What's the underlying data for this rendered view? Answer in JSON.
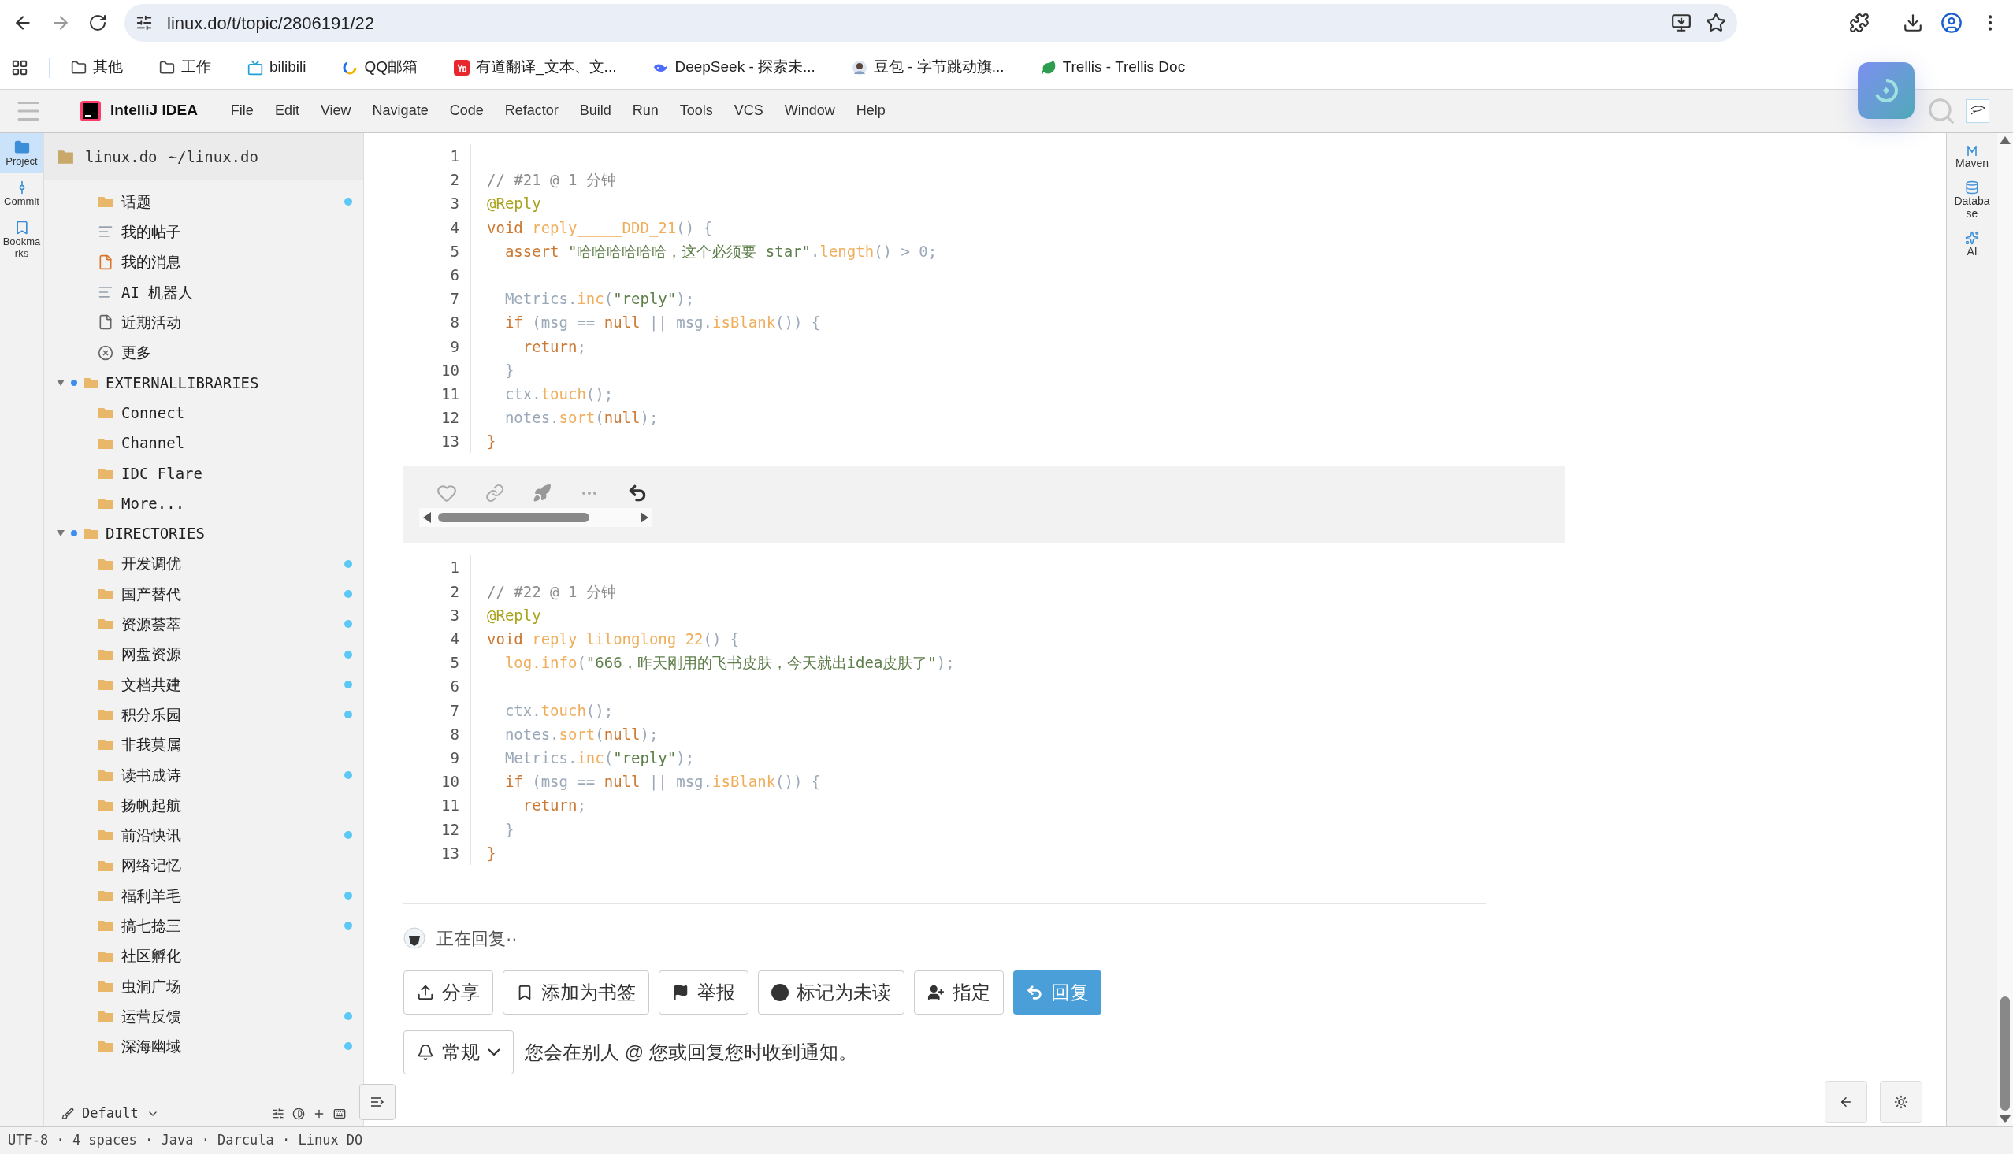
{
  "browser": {
    "url": "linux.do/t/topic/2806191/22",
    "bookmarks": [
      {
        "label": "其他",
        "kind": "folder"
      },
      {
        "label": "工作",
        "kind": "folder"
      },
      {
        "label": "bilibili",
        "kind": "tv"
      },
      {
        "label": "QQ邮箱",
        "kind": "ring"
      },
      {
        "label": "有道翻译_文本、文...",
        "kind": "yd"
      },
      {
        "label": "DeepSeek - 探索未...",
        "kind": "whale"
      },
      {
        "label": "豆包 - 字节跳动旗...",
        "kind": "avatar"
      },
      {
        "label": "Trellis - Trellis Doc",
        "kind": "leaf"
      }
    ]
  },
  "ide": {
    "app_name": "IntelliJ IDEA",
    "menu": [
      "File",
      "Edit",
      "View",
      "Navigate",
      "Code",
      "Refactor",
      "Build",
      "Run",
      "Tools",
      "VCS",
      "Window",
      "Help"
    ],
    "left_tools": [
      {
        "label": "Project",
        "kind": "folder",
        "selected": true
      },
      {
        "label": "Commit",
        "kind": "commit",
        "selected": false
      },
      {
        "label": "Bookmarks",
        "kind": "bookmark",
        "selected": false
      }
    ],
    "right_tools": [
      {
        "label": "Maven",
        "kind": "maven"
      },
      {
        "label": "Database",
        "kind": "database"
      },
      {
        "label": "AI",
        "kind": "sparkle"
      }
    ]
  },
  "sidebar": {
    "project": "linux.do",
    "path": "~/linux.do",
    "items": [
      {
        "label": "话题",
        "kind": "folder",
        "dot": true
      },
      {
        "label": "我的帖子",
        "kind": "lines",
        "dot": false
      },
      {
        "label": "我的消息",
        "kind": "file-orange",
        "dot": false
      },
      {
        "label": "AI 机器人",
        "kind": "lines",
        "dot": false
      },
      {
        "label": "近期活动",
        "kind": "file",
        "dot": false
      },
      {
        "label": "更多",
        "kind": "more",
        "dot": false
      },
      {
        "label": "EXTERNALLIBRARIES",
        "kind": "group",
        "expanded": true,
        "children": [
          {
            "label": "Connect",
            "kind": "folder",
            "dot": false
          },
          {
            "label": "Channel",
            "kind": "folder",
            "dot": false
          },
          {
            "label": "IDC Flare",
            "kind": "folder",
            "dot": false
          },
          {
            "label": "More...",
            "kind": "folder",
            "dot": false
          }
        ]
      },
      {
        "label": "DIRECTORIES",
        "kind": "group",
        "expanded": true,
        "children": [
          {
            "label": "开发调优",
            "kind": "folder",
            "dot": true
          },
          {
            "label": "国产替代",
            "kind": "folder",
            "dot": true
          },
          {
            "label": "资源荟萃",
            "kind": "folder",
            "dot": true
          },
          {
            "label": "网盘资源",
            "kind": "folder",
            "dot": true
          },
          {
            "label": "文档共建",
            "kind": "folder",
            "dot": true
          },
          {
            "label": "积分乐园",
            "kind": "folder",
            "dot": true
          },
          {
            "label": "非我莫属",
            "kind": "folder",
            "dot": false
          },
          {
            "label": "读书成诗",
            "kind": "folder",
            "dot": true
          },
          {
            "label": "扬帆起航",
            "kind": "folder",
            "dot": false
          },
          {
            "label": "前沿快讯",
            "kind": "folder",
            "dot": true
          },
          {
            "label": "网络记忆",
            "kind": "folder",
            "dot": false
          },
          {
            "label": "福利羊毛",
            "kind": "folder",
            "dot": true
          },
          {
            "label": "搞七捻三",
            "kind": "folder",
            "dot": true
          },
          {
            "label": "社区孵化",
            "kind": "folder",
            "dot": false
          },
          {
            "label": "虫洞广场",
            "kind": "folder",
            "dot": false
          },
          {
            "label": "运营反馈",
            "kind": "folder",
            "dot": true
          },
          {
            "label": "深海幽域",
            "kind": "folder",
            "dot": true
          }
        ]
      }
    ],
    "theme": "Default"
  },
  "posts": [
    {
      "lines": [
        {
          "number": "1"
        },
        {
          "number": "2",
          "tokens": [
            {
              "t": "// #21 @ 1 分钟",
              "kind": "comment"
            }
          ]
        },
        {
          "number": "3",
          "tokens": [
            {
              "t": "@Reply",
              "kind": "annotation"
            }
          ]
        },
        {
          "number": "4",
          "tokens": [
            {
              "t": "void ",
              "kind": "keyword"
            },
            {
              "t": "reply_____DDD_21",
              "kind": "function"
            },
            {
              "t": "() {",
              "kind": "plain"
            }
          ]
        },
        {
          "number": "5",
          "tokens": [
            {
              "t": "  assert ",
              "kind": "keyword"
            },
            {
              "t": "\"哈哈哈哈哈哈，这个必须要 star\"",
              "kind": "string"
            },
            {
              "t": ".",
              "kind": "plain"
            },
            {
              "t": "length",
              "kind": "function"
            },
            {
              "t": "() > 0;",
              "kind": "plain"
            }
          ]
        },
        {
          "number": "6"
        },
        {
          "number": "7",
          "tokens": [
            {
              "t": "  Metrics.",
              "kind": "plain"
            },
            {
              "t": "inc",
              "kind": "function"
            },
            {
              "t": "(",
              "kind": "plain"
            },
            {
              "t": "\"reply\"",
              "kind": "string"
            },
            {
              "t": ");",
              "kind": "plain"
            }
          ]
        },
        {
          "number": "8",
          "tokens": [
            {
              "t": "  if ",
              "kind": "keyword"
            },
            {
              "t": "(msg == ",
              "kind": "plain"
            },
            {
              "t": "null",
              "kind": "keyword"
            },
            {
              "t": " || msg.",
              "kind": "plain"
            },
            {
              "t": "isBlank",
              "kind": "function"
            },
            {
              "t": "()) {",
              "kind": "plain"
            }
          ]
        },
        {
          "number": "9",
          "tokens": [
            {
              "t": "    return",
              "kind": "keyword"
            },
            {
              "t": ";",
              "kind": "plain"
            }
          ]
        },
        {
          "number": "10",
          "tokens": [
            {
              "t": "  }",
              "kind": "plain"
            }
          ]
        },
        {
          "number": "11",
          "tokens": [
            {
              "t": "  ctx.",
              "kind": "plain"
            },
            {
              "t": "touch",
              "kind": "function"
            },
            {
              "t": "();",
              "kind": "plain"
            }
          ]
        },
        {
          "number": "12",
          "tokens": [
            {
              "t": "  notes.",
              "kind": "plain"
            },
            {
              "t": "sort",
              "kind": "function"
            },
            {
              "t": "(",
              "kind": "plain"
            },
            {
              "t": "null",
              "kind": "keyword"
            },
            {
              "t": ");",
              "kind": "plain"
            }
          ]
        },
        {
          "number": "13",
          "tokens": [
            {
              "t": "}",
              "kind": "keyword"
            }
          ]
        }
      ],
      "actions": true
    },
    {
      "lines": [
        {
          "number": "1"
        },
        {
          "number": "2",
          "tokens": [
            {
              "t": "// #22 @ 1 分钟",
              "kind": "comment"
            }
          ]
        },
        {
          "number": "3",
          "tokens": [
            {
              "t": "@Reply",
              "kind": "annotation"
            }
          ]
        },
        {
          "number": "4",
          "tokens": [
            {
              "t": "void ",
              "kind": "keyword"
            },
            {
              "t": "reply_lilonglong_22",
              "kind": "function"
            },
            {
              "t": "() {",
              "kind": "plain"
            }
          ]
        },
        {
          "number": "5",
          "tokens": [
            {
              "t": "  log.info",
              "kind": "function"
            },
            {
              "t": "(",
              "kind": "plain"
            },
            {
              "t": "\"666，昨天刚用的飞书皮肤，今天就出idea皮肤了\"",
              "kind": "string"
            },
            {
              "t": ");",
              "kind": "plain"
            }
          ]
        },
        {
          "number": "6"
        },
        {
          "number": "7",
          "tokens": [
            {
              "t": "  ctx.",
              "kind": "plain"
            },
            {
              "t": "touch",
              "kind": "function"
            },
            {
              "t": "();",
              "kind": "plain"
            }
          ]
        },
        {
          "number": "8",
          "tokens": [
            {
              "t": "  notes.",
              "kind": "plain"
            },
            {
              "t": "sort",
              "kind": "function"
            },
            {
              "t": "(",
              "kind": "plain"
            },
            {
              "t": "null",
              "kind": "keyword"
            },
            {
              "t": ");",
              "kind": "plain"
            }
          ]
        },
        {
          "number": "9",
          "tokens": [
            {
              "t": "  Metrics.",
              "kind": "plain"
            },
            {
              "t": "inc",
              "kind": "function"
            },
            {
              "t": "(",
              "kind": "plain"
            },
            {
              "t": "\"reply\"",
              "kind": "string"
            },
            {
              "t": ");",
              "kind": "plain"
            }
          ]
        },
        {
          "number": "10",
          "tokens": [
            {
              "t": "  if ",
              "kind": "keyword"
            },
            {
              "t": "(msg == ",
              "kind": "plain"
            },
            {
              "t": "null",
              "kind": "keyword"
            },
            {
              "t": " || msg.",
              "kind": "plain"
            },
            {
              "t": "isBlank",
              "kind": "function"
            },
            {
              "t": "()) {",
              "kind": "plain"
            }
          ]
        },
        {
          "number": "11",
          "tokens": [
            {
              "t": "    return",
              "kind": "keyword"
            },
            {
              "t": ";",
              "kind": "plain"
            }
          ]
        },
        {
          "number": "12",
          "tokens": [
            {
              "t": "  }",
              "kind": "plain"
            }
          ]
        },
        {
          "number": "13",
          "tokens": [
            {
              "t": "}",
              "kind": "keyword"
            }
          ]
        }
      ],
      "actions": false
    }
  ],
  "reply_status": "正在回复··",
  "topic_buttons": [
    {
      "label": "分享",
      "kind": "share",
      "primary": false
    },
    {
      "label": "添加为书签",
      "kind": "bookmark",
      "primary": false
    },
    {
      "label": "举报",
      "kind": "flag",
      "primary": false
    },
    {
      "label": "标记为未读",
      "kind": "dot",
      "primary": false
    },
    {
      "label": "指定",
      "kind": "assign",
      "primary": false
    },
    {
      "label": "回复",
      "kind": "reply",
      "primary": true
    }
  ],
  "notification": {
    "level": "常规",
    "text": "您会在别人 @ 您或回复您时收到通知。"
  },
  "status_bar": "UTF-8 · 4 spaces · Java · Darcula · Linux DO"
}
